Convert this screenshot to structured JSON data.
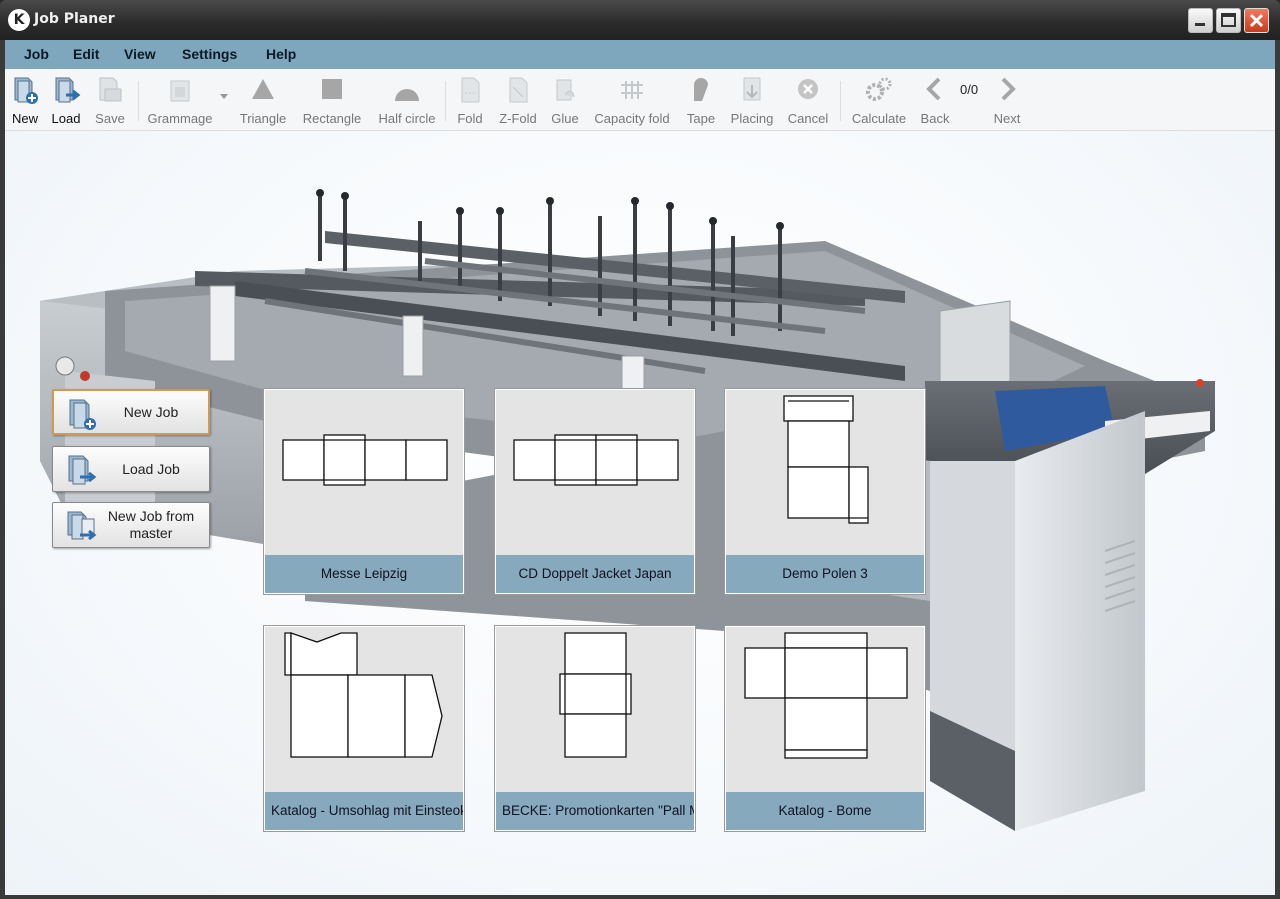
{
  "window": {
    "title": "Job Planer",
    "logo_letter": "K"
  },
  "menu": [
    "Job",
    "Edit",
    "View",
    "Settings",
    "Help"
  ],
  "toolbar": {
    "new": "New",
    "load": "Load",
    "save": "Save",
    "grammage": "Grammage",
    "triangle": "Triangle",
    "rectangle": "Rectangle",
    "half_circle": "Half circle",
    "fold": "Fold",
    "z_fold": "Z-Fold",
    "glue": "Glue",
    "capacity_fold": "Capacity fold",
    "tape": "Tape",
    "placing": "Placing",
    "cancel": "Cancel",
    "calculate": "Calculate",
    "back": "Back",
    "counter": "0/0",
    "next": "Next"
  },
  "sidebar": {
    "new_job": "New Job",
    "load_job": "Load Job",
    "new_job_from_master": "New Job from master"
  },
  "jobs": [
    {
      "name": "Messe Leipzig"
    },
    {
      "name": "CD Doppelt Jacket Japan"
    },
    {
      "name": "Demo Polen 3"
    },
    {
      "name": "Katalog - Umsohlag mit Einsteokta"
    },
    {
      "name": "BECKE: Promotionkarten \"Pall Ma"
    },
    {
      "name": "Katalog - Bome"
    }
  ],
  "colors": {
    "menubar": "#7ea6bd",
    "card_caption": "#86a9bd",
    "focus_border": "#d09a55",
    "close_button": "#d24a2a"
  }
}
